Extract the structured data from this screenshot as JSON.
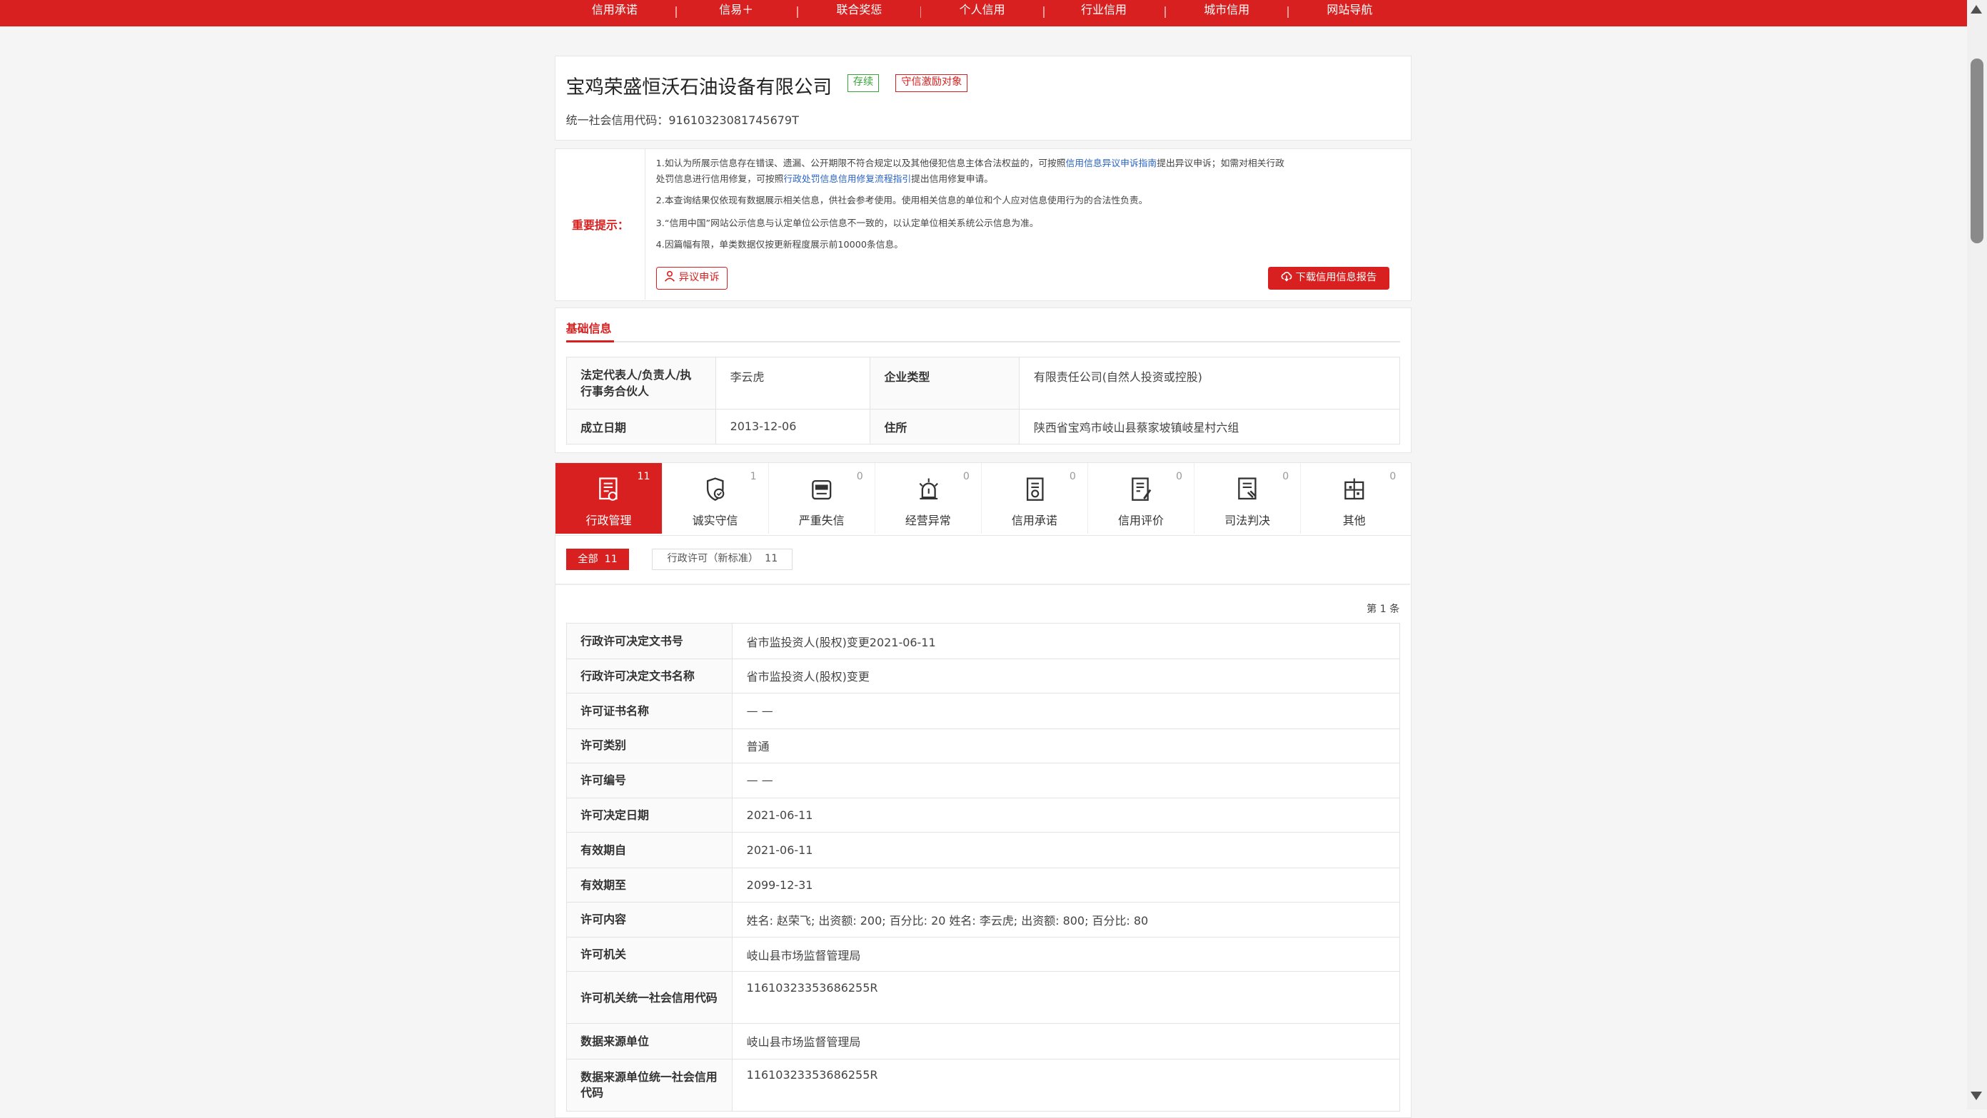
{
  "nav": {
    "items": [
      "信用承诺",
      "信易＋",
      "联合奖惩",
      "个人信用",
      "行业信用",
      "城市信用",
      "网站导航"
    ]
  },
  "company": {
    "name": "宝鸡荣盛恒沃石油设备有限公司",
    "status_badge": "存续",
    "honor_badge": "守信激励对象",
    "credit_code_label": "统一社会信用代码：",
    "credit_code": "91610323081745679T"
  },
  "notice": {
    "label": "重要提示：",
    "line1a": "1.如认为所展示信息存在错误、遗漏、公开期限不符合规定以及其他侵犯信息主体合法权益的，可按照",
    "line1_link": "信用信息异议申诉指南",
    "line1b": "提出异议申诉；如需对相关行政",
    "line2a": "处罚信息进行信用修复，可按照",
    "line2_link": "行政处罚信息信用修复流程指引",
    "line2b": "提出信用修复申请。",
    "line3": "2.本查询结果仅依现有数据展示相关信息，供社会参考使用。使用相关信息的单位和个人应对信息使用行为的合法性负责。",
    "line4": "3.“信用中国”网站公示信息与认定单位公示信息不一致的，以认定单位相关系统公示信息为准。",
    "line5": "4.因篇幅有限，单类数据仅按更新程度展示前10000条信息。",
    "dispute_button": "异议申诉",
    "download_button": "下载信用信息报告"
  },
  "basic": {
    "title": "基础信息",
    "legal_rep_label": "法定代表人/负责人/执行事务合伙人",
    "legal_rep": "李云虎",
    "type_label": "企业类型",
    "type": "有限责任公司(自然人投资或控股)",
    "founded_label": "成立日期",
    "founded": "2013-12-06",
    "address_label": "住所",
    "address": "陕西省宝鸡市岐山县蔡家坡镇岐星村六组"
  },
  "tabs": [
    {
      "label": "行政管理",
      "count": "11",
      "icon": "admin-document-icon"
    },
    {
      "label": "诚实守信",
      "count": "1",
      "icon": "honesty-shield-icon"
    },
    {
      "label": "严重失信",
      "count": "0",
      "icon": "blacklist-icon"
    },
    {
      "label": "经营异常",
      "count": "0",
      "icon": "alarm-icon"
    },
    {
      "label": "信用承诺",
      "count": "0",
      "icon": "promise-document-icon"
    },
    {
      "label": "信用评价",
      "count": "0",
      "icon": "evaluation-icon"
    },
    {
      "label": "司法判决",
      "count": "0",
      "icon": "judgment-icon"
    },
    {
      "label": "其他",
      "count": "0",
      "icon": "other-icon"
    }
  ],
  "filters": {
    "all": "全部",
    "all_count": "11",
    "license": "行政许可（新标准）",
    "license_count": "11"
  },
  "page_info": "第 1 条",
  "record": [
    {
      "key": "行政许可决定文书号",
      "value": "省市监投资人(股权)变更2021-06-11"
    },
    {
      "key": "行政许可决定文书名称",
      "value": "省市监投资人(股权)变更"
    },
    {
      "key": "许可证书名称",
      "value": "— —"
    },
    {
      "key": "许可类别",
      "value": "普通"
    },
    {
      "key": "许可编号",
      "value": "— —"
    },
    {
      "key": "许可决定日期",
      "value": "2021-06-11"
    },
    {
      "key": "有效期自",
      "value": "2021-06-11"
    },
    {
      "key": "有效期至",
      "value": "2099-12-31"
    },
    {
      "key": "许可内容",
      "value": "姓名: 赵荣飞; 出资额: 200; 百分比: 20 姓名: 李云虎; 出资额: 800; 百分比: 80"
    },
    {
      "key": "许可机关",
      "value": "岐山县市场监督管理局"
    },
    {
      "key": "许可机关统一社会信用代码",
      "value": "11610323353686255R"
    },
    {
      "key": "数据来源单位",
      "value": "岐山县市场监督管理局"
    },
    {
      "key": "数据来源单位统一社会信用代码",
      "value": "11610323353686255R"
    }
  ],
  "colors": {
    "brand": "#d7201f",
    "status_green": "#3aa33a",
    "link": "#2a64c2"
  }
}
